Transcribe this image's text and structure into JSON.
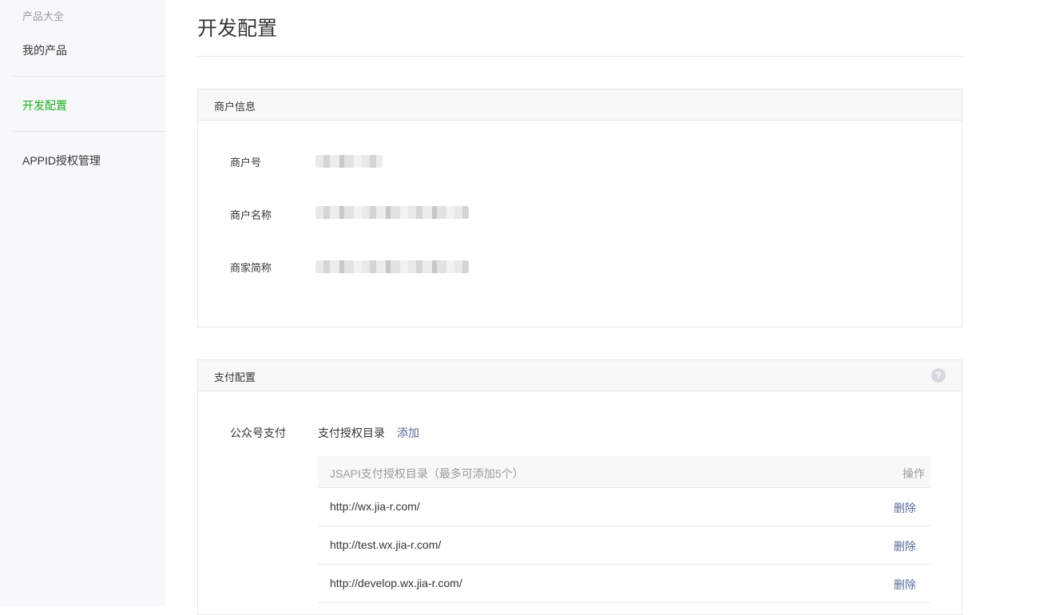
{
  "sidebar": {
    "category": "产品大全",
    "items": [
      {
        "label": "我的产品"
      },
      {
        "label": "开发配置"
      },
      {
        "label": "APPID授权管理"
      }
    ],
    "active_color": "#1aad19"
  },
  "page": {
    "title": "开发配置"
  },
  "merchant_panel": {
    "title": "商户信息",
    "fields": [
      {
        "label": "商户号"
      },
      {
        "label": "商户名称"
      },
      {
        "label": "商家简称"
      }
    ]
  },
  "pay_panel": {
    "title": "支付配置",
    "help_icon": "question-circle-icon",
    "help_glyph": "?",
    "section_label": "公众号支付",
    "dir_label": "支付授权目录",
    "add_label": "添加",
    "table": {
      "columns": [
        "JSAPI支付授权目录（最多可添加5个）",
        "操作"
      ],
      "rows": [
        {
          "url": "http://wx.jia-r.com/",
          "action": "删除"
        },
        {
          "url": "http://test.wx.jia-r.com/",
          "action": "删除"
        },
        {
          "url": "http://develop.wx.jia-r.com/",
          "action": "删除"
        }
      ]
    },
    "link_color": "#576b95"
  }
}
